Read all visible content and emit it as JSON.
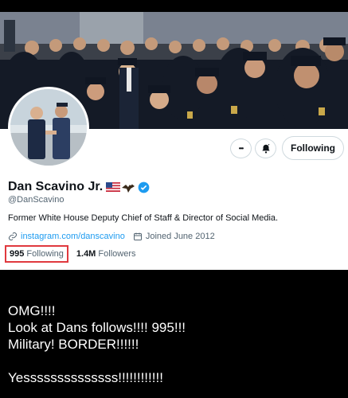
{
  "profile": {
    "name": "Dan Scavino Jr.",
    "handle": "@DanScavino",
    "bio": "Former White House Deputy Chief of Staff & Director of Social Media.",
    "link": "instagram.com/danscavino",
    "joined": "Joined June 2012",
    "following_count": "995",
    "following_label": "Following",
    "followers_count": "1.4M",
    "followers_label": "Followers"
  },
  "actions": {
    "more_label": "•••",
    "follow_button_label": "Following"
  },
  "caption": {
    "lines": [
      "OMG!!!!",
      "Look at Dans follows!!!! 995!!!",
      "Military! BORDER!!!!!!",
      "",
      "Yessssssssssssss!!!!!!!!!!!!"
    ]
  },
  "icons": [
    "more-icon",
    "bell-icon",
    "verified-badge-icon",
    "us-flag-icon",
    "eagle-icon",
    "link-icon",
    "calendar-icon"
  ],
  "colors": {
    "accent": "#1d9bf0",
    "highlight_box": "#e0393e"
  }
}
